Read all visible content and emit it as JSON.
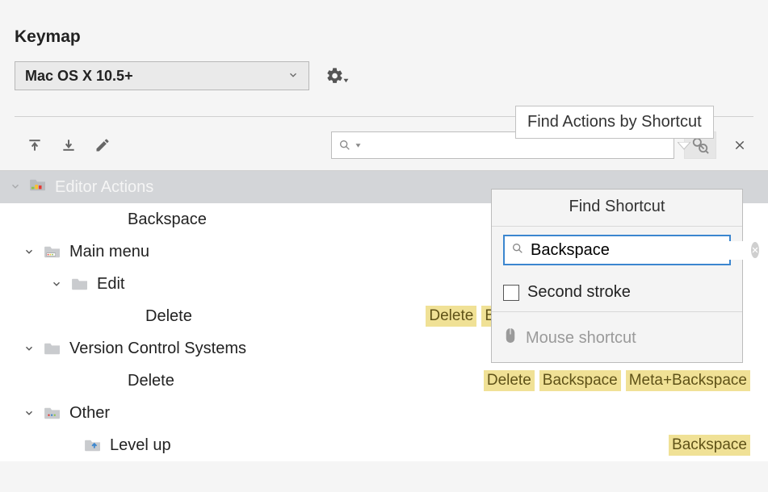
{
  "title": "Keymap",
  "scheme": {
    "selected": "Mac OS X 10.5+"
  },
  "tooltip": "Find Actions by Shortcut",
  "search": {
    "value": "",
    "placeholder": ""
  },
  "tree": {
    "editor_actions": {
      "label": "Editor Actions",
      "items": [
        {
          "label": "Backspace",
          "shortcuts": []
        }
      ]
    },
    "main_menu": {
      "label": "Main menu",
      "edit": {
        "label": "Edit",
        "items": [
          {
            "label": "Delete",
            "shortcuts": [
              "Delete",
              "B"
            ]
          }
        ]
      }
    },
    "vcs": {
      "label": "Version Control Systems",
      "items": [
        {
          "label": "Delete",
          "shortcuts": [
            "Delete",
            "Backspace",
            "Meta+Backspace"
          ]
        }
      ]
    },
    "other": {
      "label": "Other",
      "items": [
        {
          "label": "Level up",
          "shortcuts": [
            "Backspace"
          ]
        }
      ]
    }
  },
  "popup": {
    "title": "Find Shortcut",
    "search_value": "Backspace",
    "second_stroke_label": "Second stroke",
    "mouse_shortcut_label": "Mouse shortcut"
  }
}
